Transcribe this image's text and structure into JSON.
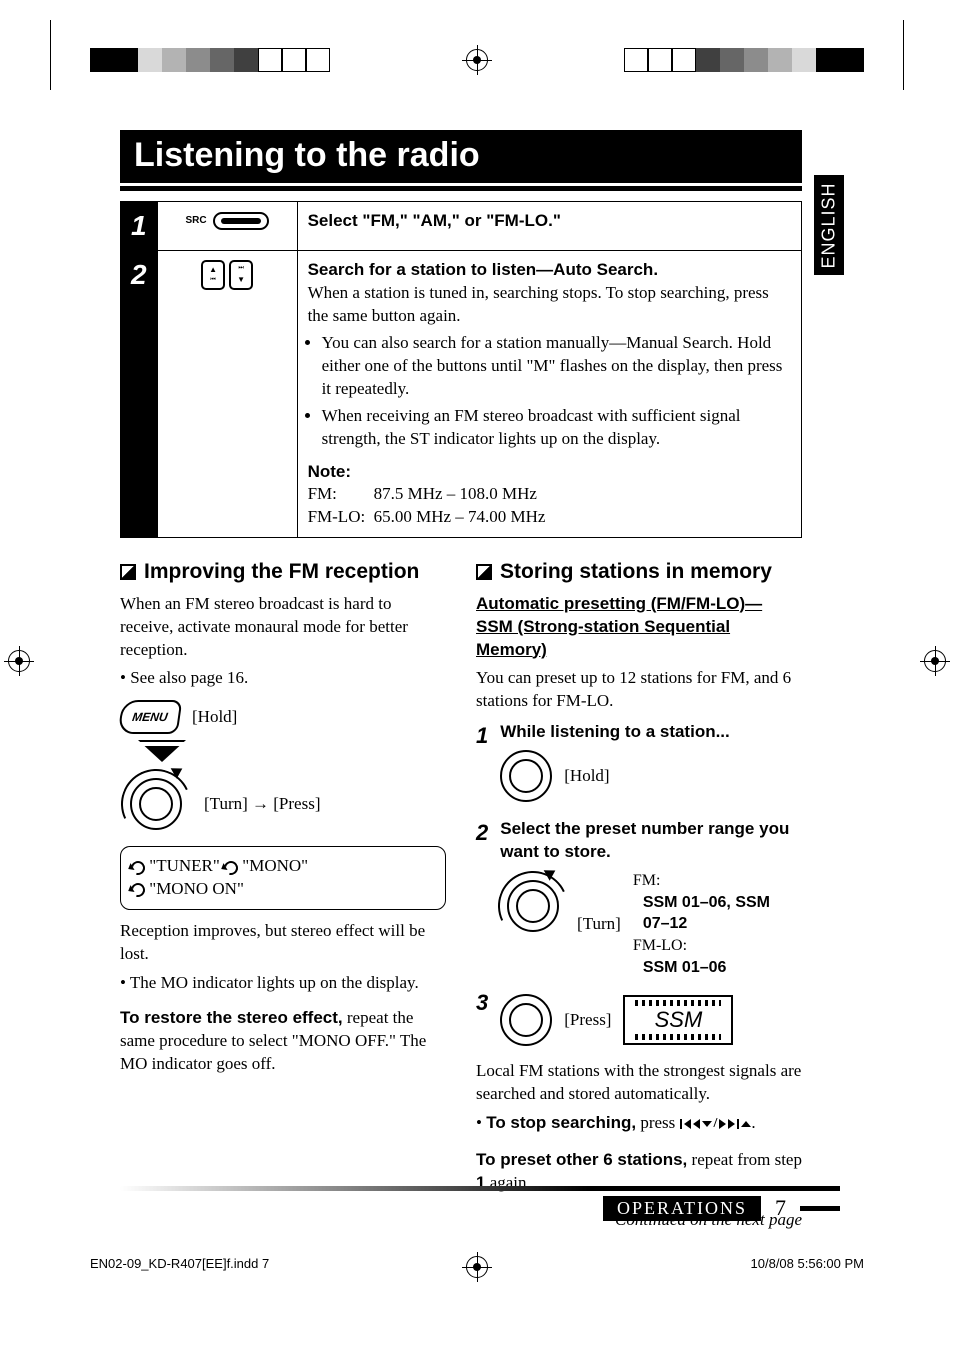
{
  "meta": {
    "lang_tab": "ENGLISH",
    "title": "Listening to the radio",
    "footer_label": "OPERATIONS",
    "page_number": "7",
    "print_file": "EN02-09_KD-R407[EE]f.indd   7",
    "print_datetime": "10/8/08   5:56:00 PM"
  },
  "steps": {
    "row1": {
      "num": "1",
      "icon_label": "SRC",
      "heading": "Select \"FM,\" \"AM,\" or \"FM-LO.\""
    },
    "row2": {
      "num": "2",
      "heading": "Search for a station to listen—Auto Search.",
      "body": "When a station is tuned in, searching stops. To stop searching, press the same button again.",
      "bullet1": "You can also search for a station manually—Manual Search. Hold either one of the buttons until \"M\" flashes on the display, then press it repeatedly.",
      "bullet2": "When receiving an FM stereo broadcast with sufficient signal strength, the ST indicator lights up on the display.",
      "note_label": "Note:",
      "note_fm_k": "FM:",
      "note_fm_v": "87.5 MHz – 108.0 MHz",
      "note_fmlo_k": "FM-LO:",
      "note_fmlo_v": "65.00 MHz – 74.00 MHz"
    }
  },
  "left": {
    "heading": "Improving the FM reception",
    "intro1": "When an FM stereo broadcast is hard to receive, activate monaural mode for better reception.",
    "bullet_seealso": "See also page 16.",
    "menu_btn": "MENU",
    "hold": "[Hold]",
    "turn_press": "[Turn] → [Press]",
    "path": "\"TUNER\" ",
    "path2": " \"MONO\"",
    "path3": "\"MONO ON\"",
    "after1": "Reception improves, but stereo effect will be lost.",
    "after_bullet": "The MO indicator lights up on the display.",
    "restore_lead": "To restore the stereo effect,",
    "restore_rest": " repeat the same procedure to select \"MONO OFF.\" The MO indicator goes off."
  },
  "right": {
    "heading": "Storing stations in memory",
    "sub1": "Automatic presetting (FM/FM-LO)—",
    "sub2": "SSM (Strong-station Sequential Memory)",
    "intro": "You can preset up to 12 stations for FM, and 6 stations for FM-LO.",
    "s1_num": "1",
    "s1_text": "While listening to a station...",
    "s1_action": "[Hold]",
    "s2_num": "2",
    "s2_text": "Select the preset number range you want to store.",
    "s2_action": "[Turn]",
    "s2_fm_label": "FM:",
    "s2_fm_val": "SSM 01–06, SSM 07–12",
    "s2_fmlo_label": "FM-LO:",
    "s2_fmlo_val": "SSM 01–06",
    "s3_num": "3",
    "s3_action": "[Press]",
    "ssm_display": "SSM",
    "result": "Local FM stations with the strongest signals are searched and stored automatically.",
    "stop_lead": "To stop searching,",
    "stop_rest": " press ",
    "stop_tail": ".",
    "preset_lead": "To preset other 6 stations,",
    "preset_rest": " repeat from step ",
    "preset_step": "1",
    "preset_tail": " again.",
    "continued": "Continued on the next page"
  }
}
